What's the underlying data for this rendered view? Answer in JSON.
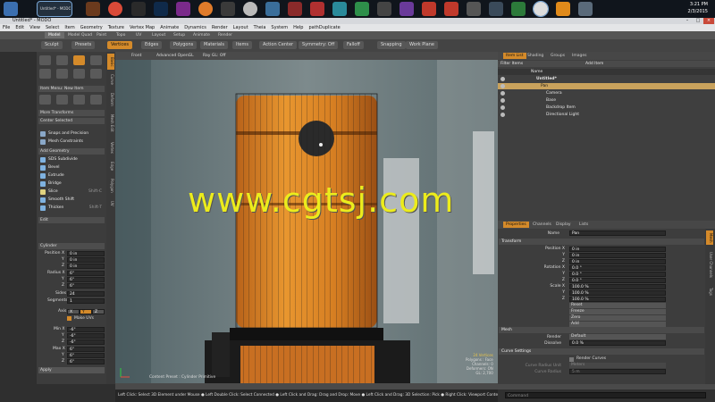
{
  "window": {
    "title": "Untitled* - MODO"
  },
  "tray": {
    "time": "3:21 PM",
    "date": "2/3/2015"
  },
  "menu": [
    "File",
    "Edit",
    "View",
    "Select",
    "Item",
    "Geometry",
    "Texture",
    "Vertex Map",
    "Animate",
    "Dynamics",
    "Render",
    "Layout",
    "Theia",
    "System",
    "Help",
    "pathDuplicate"
  ],
  "layout_tabs": [
    "Model",
    "Model Quad",
    "Paint",
    "Topo",
    "UV",
    "Layout",
    "Setup",
    "Animate",
    "Render"
  ],
  "toolbar": {
    "sculpt": "Sculpt",
    "presets": "Presets",
    "vertices": "Vertices",
    "edges": "Edges",
    "polygons": "Polygons",
    "materials": "Materials",
    "items": "Items",
    "action_center": "Action Center",
    "symmetry": "Symmetry: Off",
    "falloff": "Falloff",
    "snapping": "Snapping",
    "work_plane": "Work Plane"
  },
  "left_panel": {
    "item_menu": "Item Menu: New Item",
    "more_transforms": "More Transforms",
    "center_selected": "Center Selected",
    "snaps_precision": "Snaps and Precision",
    "mesh_constraints": "Mesh Constraints",
    "add_geometry": "Add Geometry",
    "tools": [
      "SDS Subdivide",
      "Bevel",
      "Extrude",
      "Bridge",
      "Slice",
      "Smooth Shift",
      "Thicken"
    ],
    "slice_hint": "Shift-C",
    "thicken_hint": "Shift-T",
    "edit_label": "Edit",
    "vtabs": [
      "Basic",
      "Curve",
      "Deform",
      "Mesh Edit",
      "Vertex",
      "Edge",
      "Polygon",
      "UV"
    ]
  },
  "cylinder": {
    "header": "Cylinder",
    "position_label": "Position X",
    "y_label": "Y",
    "z_label": "Z",
    "position": [
      "0 in",
      "0 in",
      "0 in"
    ],
    "radius_label": "Radius X",
    "radius": [
      "6\"",
      "6\"",
      "6\""
    ],
    "sides_label": "Sides",
    "sides": "24",
    "segments_label": "Segments",
    "segments": "1",
    "axis_label": "Axis",
    "axis_x": "X",
    "axis_y": "Y",
    "axis_z": "Z",
    "make_uvs": "Make UVs",
    "min_label": "Min X",
    "min": [
      "-6\"",
      "-6\"",
      "-6\""
    ],
    "max_label": "Max X",
    "max": [
      "6\"",
      "6\"",
      "6\""
    ],
    "apply": "Apply"
  },
  "viewport": {
    "front": "Front",
    "advanced_opengl": "Advanced OpenGL",
    "ray_gl": "Ray GL: Off",
    "content_preset": "Content Preset : Cylinder Primitive",
    "stats": [
      "24 Vertices",
      "Polygons : Face",
      "Channels: 0",
      "Deformers: ON",
      "GL: 2,700"
    ],
    "watermark": "www.cgtsj.com"
  },
  "right_tabs": [
    "Item List",
    "Shading",
    "Groups",
    "Images"
  ],
  "item_list": {
    "filter": "Filter Items",
    "add_item": "Add Item",
    "name_col": "Name",
    "items": [
      {
        "name": "Untitled*",
        "indent": 0
      },
      {
        "name": "Pan",
        "indent": 1,
        "selected": true
      },
      {
        "name": "Camera",
        "indent": 1
      },
      {
        "name": "Base",
        "indent": 1
      },
      {
        "name": "Backdrop Item",
        "indent": 1
      },
      {
        "name": "Directional Light",
        "indent": 1
      }
    ]
  },
  "prop_tabs": [
    "Properties",
    "Channels",
    "Display",
    "Lists"
  ],
  "properties": {
    "name_label": "Name",
    "name_value": "Pan",
    "transform": "Transform",
    "position_label": "Position X",
    "position": [
      "0 in",
      "0 in",
      "0 in"
    ],
    "rotation_label": "Rotation X",
    "rotation": [
      "0.0 °",
      "0.0 °",
      "0.0 °"
    ],
    "scale_label": "Scale X",
    "scale": [
      "100.0 %",
      "100.0 %",
      "100.0 %"
    ],
    "y": "Y",
    "z": "Z",
    "buttons": [
      "Reset",
      "Freeze",
      "Zero",
      "Add"
    ],
    "mesh": "Mesh",
    "render_label": "Render",
    "render_value": "Default",
    "dissolve_label": "Dissolve",
    "dissolve_value": "0.0 %",
    "curve_settings": "Curve Settings",
    "render_curves": "Render Curves",
    "curve_radius_unit_label": "Curve Radius Unit",
    "curve_radius_unit_value": "Meters",
    "curve_radius_label": "Curve Radius",
    "curve_radius_value": "5 m",
    "vtabs": [
      "Mesh",
      "User Channels",
      "Tags"
    ]
  },
  "status": "Left Click: Select 3D Element under Mouse ● Left Double Click: Select Connected ● Left Click and Drag: Drag and Drop: Move ● Left Click and Drag: 3D Selection: Pick ● Right Click: Viewport Context M…",
  "command": "Command"
}
